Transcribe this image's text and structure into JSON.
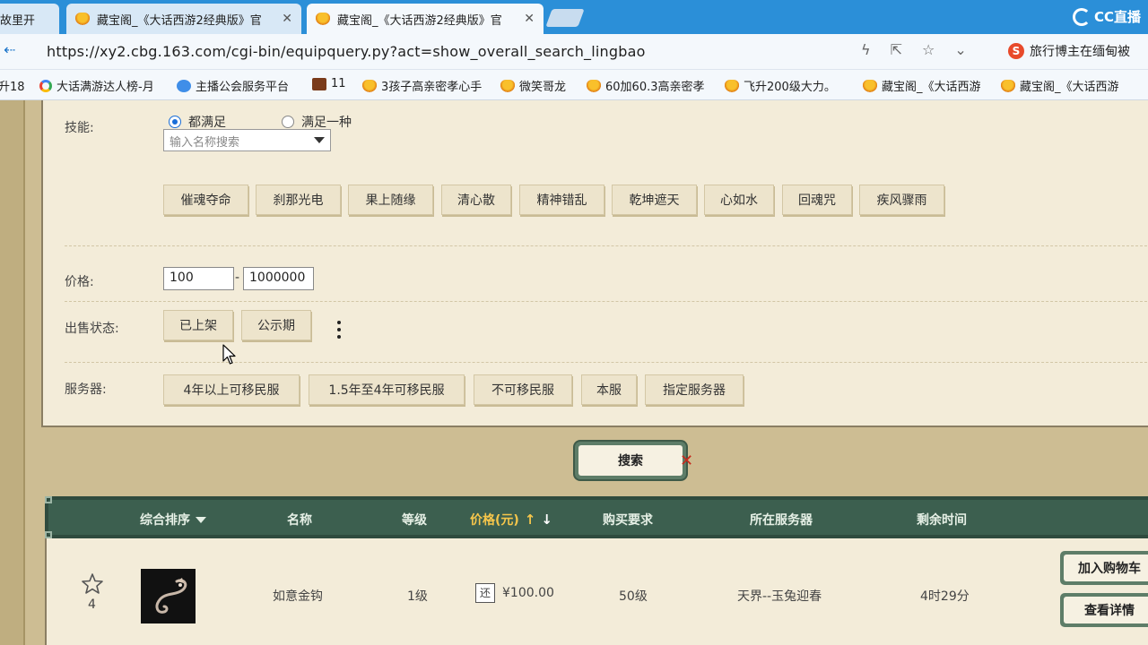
{
  "browser": {
    "tabs": [
      {
        "title": "故里开",
        "closable": false
      },
      {
        "title": "藏宝阁_《大话西游2经典版》官",
        "closable": true
      },
      {
        "title": "藏宝阁_《大话西游2经典版》官",
        "closable": true,
        "active": true
      }
    ],
    "brand": "CC直播",
    "back_icon": "back-arrow-icon",
    "url": "https://xy2.cbg.163.com/cgi-bin/equipquery.py?act=show_overall_search_lingbao",
    "search_engine_label": "旅行博主在缅甸被",
    "bookmarks": [
      {
        "label": "升18",
        "icon": "none"
      },
      {
        "label": "大话满游达人榜-月",
        "icon": "google-icon"
      },
      {
        "label": "主播公会服务平台",
        "icon": "baidu-icon"
      },
      {
        "label": "11",
        "icon": "game-icon"
      },
      {
        "label": "3孩子高亲密孝心手",
        "icon": "cbg-icon"
      },
      {
        "label": "微笑哥龙",
        "icon": "cbg-icon"
      },
      {
        "label": "60加60.3高亲密孝",
        "icon": "cbg-icon"
      },
      {
        "label": "飞升200级大力。",
        "icon": "cbg-icon"
      },
      {
        "label": "藏宝阁_《大话西游",
        "icon": "cbg-icon"
      },
      {
        "label": "藏宝阁_《大话西游",
        "icon": "cbg-icon"
      }
    ]
  },
  "filters": {
    "skill_label": "技能:",
    "radio_all": "都满足",
    "radio_any": "满足一种",
    "skill_placeholder": "输入名称搜索",
    "skills": [
      "催魂夺命",
      "刹那光电",
      "果上随缘",
      "清心散",
      "精神错乱",
      "乾坤遮天",
      "心如水",
      "回魂咒",
      "疾风骤雨"
    ],
    "price_label": "价格:",
    "price_min": "100",
    "price_max": "1000000",
    "price_dash": "-",
    "status_label": "出售状态:",
    "status_options": [
      "已上架",
      "公示期"
    ],
    "server_label": "服务器:",
    "server_options": [
      "4年以上可移民服",
      "1.5年至4年可移民服",
      "不可移民服",
      "本服",
      "指定服务器"
    ],
    "search_button": "搜索"
  },
  "table": {
    "headers": {
      "sort": "综合排序",
      "name": "名称",
      "level": "等级",
      "price": "价格(元)",
      "requirement": "购买要求",
      "server": "所在服务器",
      "remaining": "剩余时间"
    },
    "rows": [
      {
        "fav_count": "4",
        "name": "如意金钩",
        "level": "1级",
        "bargain_tag": "还",
        "price": "¥100.00",
        "requirement": "50级",
        "server": "天界--玉兔迎春",
        "remaining": "4时29分",
        "add_cart": "加入购物车",
        "view_detail": "查看详情"
      }
    ]
  }
}
